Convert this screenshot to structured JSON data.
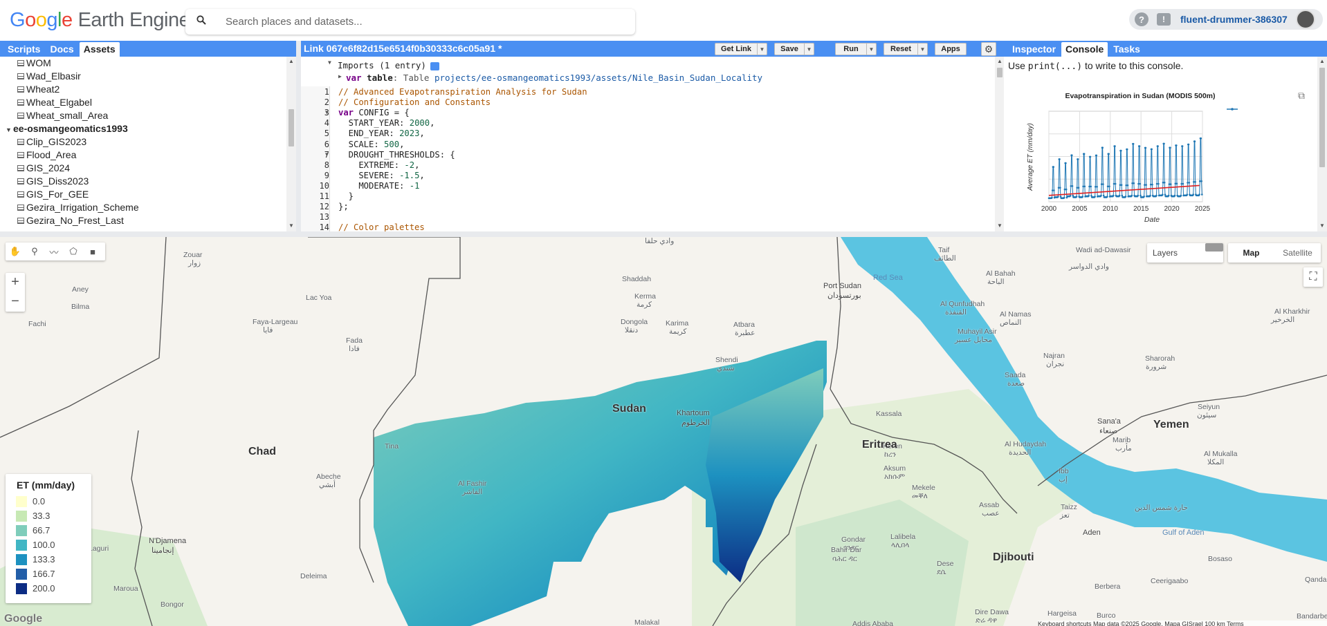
{
  "header": {
    "logo_google": [
      "G",
      "o",
      "o",
      "g",
      "l",
      "e"
    ],
    "logo_rest": "Earth Engine",
    "search_placeholder": "Search places and datasets...",
    "project": "fluent-drummer-386307"
  },
  "left_panel": {
    "tabs": [
      "Scripts",
      "Docs",
      "Assets"
    ],
    "active_tab": "Assets",
    "items": [
      {
        "label": "WOM",
        "type": "table"
      },
      {
        "label": "Wad_Elbasir",
        "type": "table"
      },
      {
        "label": "Wheat2",
        "type": "table"
      },
      {
        "label": "Wheat_Elgabel",
        "type": "table"
      },
      {
        "label": "Wheat_small_Area",
        "type": "table"
      },
      {
        "label": "ee-osmangeomatics1993",
        "type": "folder"
      },
      {
        "label": "Clip_GIS2023",
        "type": "table"
      },
      {
        "label": "Flood_Area",
        "type": "table"
      },
      {
        "label": "GIS_2024",
        "type": "table"
      },
      {
        "label": "GIS_Diss2023",
        "type": "table"
      },
      {
        "label": "GIS_For_GEE",
        "type": "table"
      },
      {
        "label": "Gezira_Irrigation_Scheme",
        "type": "table"
      },
      {
        "label": "Gezira_No_Frest_Last",
        "type": "table"
      }
    ]
  },
  "editor": {
    "title": "Link 067e6f82d15e6514f0b30333c6c05a91 *",
    "buttons": {
      "get_link": "Get Link",
      "save": "Save",
      "run": "Run",
      "reset": "Reset",
      "apps": "Apps"
    },
    "imports_header": "Imports (1 entry)",
    "import_var": "var",
    "import_name": "table",
    "import_type": ": Table",
    "import_path": "projects/ee-osmangeomatics1993/assets/Nile_Basin_Sudan_Locality",
    "lines": [
      {
        "n": "1",
        "segs": [
          {
            "c": "cm",
            "t": "// Advanced Evapotranspiration Analysis for Sudan"
          }
        ]
      },
      {
        "n": "2",
        "segs": [
          {
            "c": "cm",
            "t": "// Configuration and Constants"
          }
        ]
      },
      {
        "n": "3",
        "segs": [
          {
            "c": "kw",
            "t": "var"
          },
          {
            "c": "pr",
            "t": " CONFIG = {"
          }
        ]
      },
      {
        "n": "4",
        "segs": [
          {
            "c": "pr",
            "t": "  START_YEAR: "
          },
          {
            "c": "num",
            "t": "2000"
          },
          {
            "c": "pr",
            "t": ","
          }
        ]
      },
      {
        "n": "5",
        "segs": [
          {
            "c": "pr",
            "t": "  END_YEAR: "
          },
          {
            "c": "num",
            "t": "2023"
          },
          {
            "c": "pr",
            "t": ","
          }
        ]
      },
      {
        "n": "6",
        "segs": [
          {
            "c": "pr",
            "t": "  SCALE: "
          },
          {
            "c": "num",
            "t": "500"
          },
          {
            "c": "pr",
            "t": ","
          }
        ]
      },
      {
        "n": "7",
        "segs": [
          {
            "c": "pr",
            "t": "  DROUGHT_THRESHOLDS: {"
          }
        ]
      },
      {
        "n": "8",
        "segs": [
          {
            "c": "pr",
            "t": "    EXTREME: "
          },
          {
            "c": "num",
            "t": "-2"
          },
          {
            "c": "pr",
            "t": ","
          }
        ]
      },
      {
        "n": "9",
        "segs": [
          {
            "c": "pr",
            "t": "    SEVERE: "
          },
          {
            "c": "num",
            "t": "-1.5"
          },
          {
            "c": "pr",
            "t": ","
          }
        ]
      },
      {
        "n": "10",
        "segs": [
          {
            "c": "pr",
            "t": "    MODERATE: "
          },
          {
            "c": "num",
            "t": "-1"
          }
        ]
      },
      {
        "n": "11",
        "segs": [
          {
            "c": "pr",
            "t": "  }"
          }
        ]
      },
      {
        "n": "12",
        "segs": [
          {
            "c": "pr",
            "t": "};"
          }
        ]
      },
      {
        "n": "13",
        "segs": [
          {
            "c": "pr",
            "t": ""
          }
        ]
      },
      {
        "n": "14",
        "segs": [
          {
            "c": "cm",
            "t": "// Color palettes"
          }
        ]
      }
    ]
  },
  "right_panel": {
    "tabs": [
      "Inspector",
      "Console",
      "Tasks"
    ],
    "active_tab": "Console",
    "hint_pre": "Use ",
    "hint_code": "print(...)",
    "hint_post": " to write to this console."
  },
  "chart_data": {
    "type": "line",
    "title": "Evapotranspiration in Sudan (MODIS 500m)",
    "xlabel": "Date",
    "ylabel": "Average ET (mm/day)",
    "xlim": [
      2000,
      2025
    ],
    "x_ticks": [
      "2000",
      "2005",
      "2010",
      "2015",
      "2020",
      "2025"
    ],
    "y_ticks_visible": false,
    "grid": true,
    "legend_placement": "top-right",
    "series": [
      {
        "color": "#1f77b4",
        "annual_peaks": [
          0.45,
          0.55,
          0.5,
          0.6,
          0.55,
          0.62,
          0.58,
          0.6,
          0.7,
          0.62,
          0.72,
          0.66,
          0.68,
          0.75,
          0.72,
          0.7,
          0.68,
          0.72,
          0.75,
          0.7,
          0.73,
          0.72,
          0.74,
          0.78,
          0.82
        ],
        "annual_troughs": [
          0.04,
          0.05,
          0.04,
          0.06,
          0.05,
          0.05,
          0.06,
          0.05,
          0.06,
          0.05,
          0.06,
          0.06,
          0.05,
          0.06,
          0.06,
          0.05,
          0.06,
          0.06,
          0.07,
          0.06,
          0.06,
          0.06,
          0.07,
          0.07,
          0.07
        ]
      },
      {
        "color": "#e02020",
        "trend_start": 0.07,
        "trend_end": 0.18
      }
    ]
  },
  "map": {
    "tools": [
      "hand",
      "pin",
      "line",
      "polygon",
      "rectangle"
    ],
    "zoom_in": "+",
    "zoom_out": "−",
    "layers_label": "Layers",
    "map_types": [
      "Map",
      "Satellite"
    ],
    "active_map_type": "Map",
    "legend": {
      "title": "ET (mm/day)",
      "entries": [
        {
          "label": "0.0",
          "color": "#ffffcc"
        },
        {
          "label": "33.3",
          "color": "#c7e9b4"
        },
        {
          "label": "66.7",
          "color": "#7fcdbb"
        },
        {
          "label": "100.0",
          "color": "#41b6c4"
        },
        {
          "label": "133.3",
          "color": "#1d91c0"
        },
        {
          "label": "166.7",
          "color": "#225ea8"
        },
        {
          "label": "200.0",
          "color": "#0c2c84"
        }
      ]
    },
    "labels": {
      "countries": [
        "Sudan",
        "Chad",
        "Eritrea",
        "Yemen",
        "Djibouti"
      ],
      "cities": [
        "Khartoum",
        "الخرطوم",
        "N'Djamena",
        "إنجامينا",
        "Sana'a",
        "صنعاء",
        "Aden",
        "Port Sudan",
        "بورتسودان",
        "Kassala",
        "Zouar",
        "زوار",
        "Aney",
        "Bilma",
        "Fachi",
        "Faya-Largeau",
        "فايا",
        "Lac Yoa",
        "Fada",
        "فادا",
        "Abeche",
        "أبشي",
        "Tina",
        "Al Fashir",
        "الفاشر",
        "Shendi",
        "شندي",
        "Atbara",
        "عطبرة",
        "Karima",
        "كريمة",
        "Dongola",
        "دنقلا",
        "Kerma",
        "كرمة",
        "Shaddah",
        "وادي حلفا",
        "Taif",
        "الطائف",
        "Wadi ad-Dawasir",
        "وادي الدواسر",
        "Al Bahah",
        "الباحة",
        "Al Qunfudhah",
        "القنفذة",
        "Al Namas",
        "النماص",
        "Muhayil Asir",
        "محايل عسير",
        "Najran",
        "نجران",
        "Sharorah",
        "شرورة",
        "Al Kharkhir",
        "الخرخير",
        "Saada",
        "صعدة",
        "Seiyun",
        "سيئون",
        "Marib",
        "مأرب",
        "Al Hudaydah",
        "الحديدة",
        "Ibb",
        "إب",
        "Taizz",
        "تعز",
        "Al Mukalla",
        "المكلا",
        "Assab",
        "عصب",
        "Mekele",
        "መቐለ",
        "Aksum",
        "አክሱም",
        "Keren",
        "ከረን",
        "Gondar",
        "ጎንደር",
        "Bahir Dar",
        "ባሕር ዳር",
        "Lalibela",
        "ላሊበላ",
        "Dese",
        "ደሴ",
        "Bosaso",
        "Berbera",
        "Ceerigaabo",
        "Hargeisa",
        "Burco",
        "Dire Dawa",
        "ድሬ ዳዋ",
        "Addis Ababa",
        "Malakal",
        "Deleima",
        "Maroua",
        "Bongor",
        "Laguri",
        "Bandarbeyla",
        "Qandala",
        "حارة شمس الدين"
      ],
      "seas": [
        "Red Sea",
        "Gulf of Aden"
      ]
    },
    "attribution": "Keyboard shortcuts   Map data ©2025 Google, Mapa GISrael   100 km   Terms",
    "google_mark": "Google"
  }
}
